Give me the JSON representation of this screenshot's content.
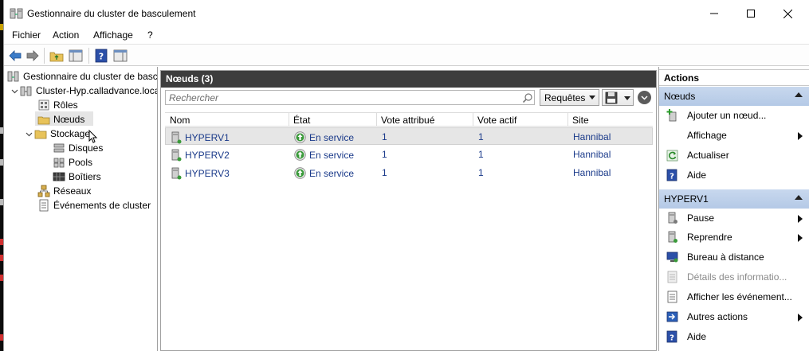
{
  "window": {
    "title": "Gestionnaire du cluster de basculement",
    "minimize_glyph": "—",
    "maximize_glyph": "☐",
    "close_glyph": "✕"
  },
  "menu": [
    "Fichier",
    "Action",
    "Affichage",
    "?"
  ],
  "toolbar": {
    "icons": [
      "back-arrow-icon",
      "forward-arrow-icon",
      "up-folder-icon",
      "show-hide-tree-icon",
      "help-icon",
      "show-hide-action-pane-icon"
    ]
  },
  "tree": {
    "root": "Gestionnaire du cluster de basculement",
    "cluster": "Cluster-Hyp.calladvance.local",
    "roles": "Rôles",
    "noeuds": "Nœuds",
    "stockage": "Stockage",
    "disques": "Disques",
    "pools": "Pools",
    "boitiers": "Boîtiers",
    "reseaux": "Réseaux",
    "evenements": "Événements de cluster"
  },
  "center": {
    "title": "Nœuds (3)",
    "search_placeholder": "Rechercher",
    "queries_label": "Requêtes",
    "columns": [
      "Nom",
      "État",
      "Vote attribué",
      "Vote actif",
      "Site"
    ],
    "rows": [
      {
        "name": "HYPERV1",
        "state": "En service",
        "vote_assigned": "1",
        "vote_active": "1",
        "site": "Hannibal"
      },
      {
        "name": "HYPERV2",
        "state": "En service",
        "vote_assigned": "1",
        "vote_active": "1",
        "site": "Hannibal"
      },
      {
        "name": "HYPERV3",
        "state": "En service",
        "vote_assigned": "1",
        "vote_active": "1",
        "site": "Hannibal"
      }
    ]
  },
  "actions": {
    "title": "Actions",
    "section1": {
      "header": "Nœuds",
      "items": [
        "Ajouter un nœud...",
        "Affichage",
        "Actualiser",
        "Aide"
      ]
    },
    "section2": {
      "header": "HYPERV1",
      "items": [
        "Pause",
        "Reprendre",
        "Bureau à distance",
        "Détails des informatio...",
        "Afficher les événement...",
        "Autres actions",
        "Aide"
      ]
    }
  },
  "colors": {
    "header_dark": "#3d3d3d",
    "section_blue": "#b4c9e6",
    "link_blue": "#1a3a8a",
    "status_green": "#3a9a3a"
  }
}
